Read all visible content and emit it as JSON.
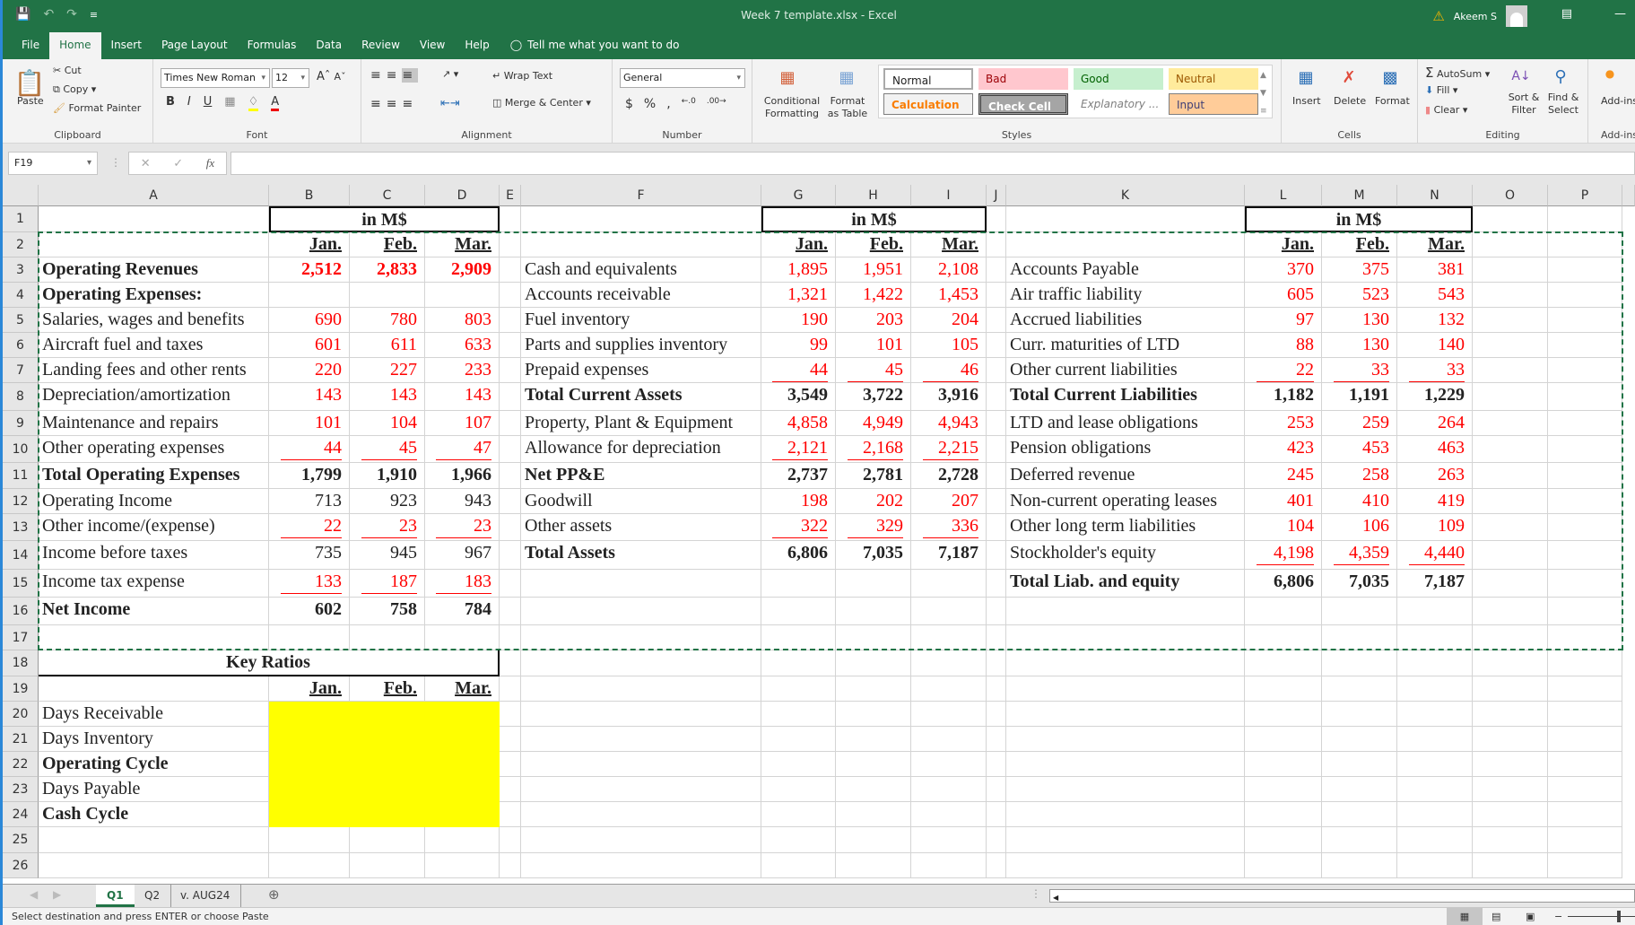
{
  "window": {
    "title": "Week 7 template.xlsx  -  Excel",
    "user": "Akeem S"
  },
  "ribbon_tabs": [
    "File",
    "Home",
    "Insert",
    "Page Layout",
    "Formulas",
    "Data",
    "Review",
    "View",
    "Help"
  ],
  "active_tab": "Home",
  "tell_me": "Tell me what you want to do",
  "clipboard": {
    "paste": "Paste",
    "cut": "Cut",
    "copy": "Copy",
    "format_painter": "Format Painter",
    "label": "Clipboard"
  },
  "font": {
    "name": "Times New Roman",
    "size": "12",
    "label": "Font",
    "bold": "B",
    "italic": "I",
    "underline": "U"
  },
  "alignment": {
    "wrap": "Wrap Text",
    "merge": "Merge & Center",
    "label": "Alignment"
  },
  "number": {
    "format": "General",
    "label": "Number",
    "currency": "$",
    "percent": "%",
    "comma": ","
  },
  "styles": {
    "conditional": "Conditional Formatting",
    "format_table": "Format as Table",
    "normal": "Normal",
    "bad": "Bad",
    "good": "Good",
    "neutral": "Neutral",
    "calculation": "Calculation",
    "check_cell": "Check Cell",
    "explanatory": "Explanatory ...",
    "input": "Input",
    "label": "Styles"
  },
  "cells_group": {
    "insert": "Insert",
    "delete": "Delete",
    "format": "Format",
    "label": "Cells"
  },
  "editing": {
    "autosum": "AutoSum",
    "fill": "Fill",
    "clear": "Clear",
    "sort": "Sort & Filter",
    "find": "Find & Select",
    "label": "Editing"
  },
  "addins": {
    "button": "Add-ins",
    "label": "Add-ins"
  },
  "formula_bar": {
    "name_box": "F19",
    "fx": "fx",
    "value": ""
  },
  "columns": [
    "A",
    "B",
    "C",
    "D",
    "E",
    "F",
    "G",
    "H",
    "I",
    "J",
    "K",
    "L",
    "M",
    "N",
    "O",
    "P"
  ],
  "rows": [
    "1",
    "2",
    "3",
    "4",
    "5",
    "6",
    "7",
    "8",
    "9",
    "10",
    "11",
    "12",
    "13",
    "14",
    "15",
    "16",
    "17",
    "18",
    "19",
    "20",
    "21",
    "22",
    "23",
    "24",
    "25",
    "26"
  ],
  "unit_label": "in M$",
  "months": [
    "Jan.",
    "Feb.",
    "Mar."
  ],
  "income_statement": [
    {
      "label": "Operating Revenues",
      "values": [
        "2,512",
        "2,833",
        "2,909"
      ],
      "bold": true,
      "red": true
    },
    {
      "label": "Operating Expenses:",
      "values": [
        "",
        "",
        ""
      ],
      "bold": true
    },
    {
      "label": "Salaries, wages and benefits",
      "values": [
        "690",
        "780",
        "803"
      ],
      "red": true
    },
    {
      "label": "Aircraft fuel and taxes",
      "values": [
        "601",
        "611",
        "633"
      ],
      "red": true
    },
    {
      "label": "Landing fees and other rents",
      "values": [
        "220",
        "227",
        "233"
      ],
      "red": true
    },
    {
      "label": "Depreciation/amortization",
      "values": [
        "143",
        "143",
        "143"
      ],
      "red": true
    },
    {
      "label": "Maintenance and repairs",
      "values": [
        "101",
        "104",
        "107"
      ],
      "red": true
    },
    {
      "label": "Other operating expenses",
      "values": [
        "44",
        "45",
        "47"
      ],
      "red": true,
      "sum": true
    },
    {
      "label": "Total Operating Expenses",
      "values": [
        "1,799",
        "1,910",
        "1,966"
      ],
      "bold": true
    },
    {
      "label": "Operating Income",
      "values": [
        "713",
        "923",
        "943"
      ]
    },
    {
      "label": "Other income/(expense)",
      "values": [
        "22",
        "23",
        "23"
      ],
      "red": true,
      "sum": true
    },
    {
      "label": "Income before taxes",
      "values": [
        "735",
        "945",
        "967"
      ]
    },
    {
      "label": "Income tax expense",
      "values": [
        "133",
        "187",
        "183"
      ],
      "red": true,
      "sum": true
    },
    {
      "label": "Net Income",
      "values": [
        "602",
        "758",
        "784"
      ],
      "bold": true
    }
  ],
  "assets": [
    {
      "label": "Cash and equivalents",
      "values": [
        "1,895",
        "1,951",
        "2,108"
      ],
      "red": true
    },
    {
      "label": "Accounts receivable",
      "values": [
        "1,321",
        "1,422",
        "1,453"
      ],
      "red": true
    },
    {
      "label": "Fuel inventory",
      "values": [
        "190",
        "203",
        "204"
      ],
      "red": true
    },
    {
      "label": "Parts and supplies inventory",
      "values": [
        "99",
        "101",
        "105"
      ],
      "red": true
    },
    {
      "label": "Prepaid expenses",
      "values": [
        "44",
        "45",
        "46"
      ],
      "red": true,
      "sum": true
    },
    {
      "label": "Total Current Assets",
      "values": [
        "3,549",
        "3,722",
        "3,916"
      ],
      "bold": true
    },
    {
      "label": "Property, Plant & Equipment",
      "values": [
        "4,858",
        "4,949",
        "4,943"
      ],
      "red": true
    },
    {
      "label": "Allowance for depreciation",
      "values": [
        "2,121",
        "2,168",
        "2,215"
      ],
      "red": true,
      "sum": true
    },
    {
      "label": "Net PP&E",
      "values": [
        "2,737",
        "2,781",
        "2,728"
      ],
      "bold": true
    },
    {
      "label": "Goodwill",
      "values": [
        "198",
        "202",
        "207"
      ],
      "red": true
    },
    {
      "label": "Other assets",
      "values": [
        "322",
        "329",
        "336"
      ],
      "red": true,
      "sum": true
    },
    {
      "label": "Total Assets",
      "values": [
        "6,806",
        "7,035",
        "7,187"
      ],
      "bold": true
    }
  ],
  "liabilities": [
    {
      "label": "Accounts Payable",
      "values": [
        "370",
        "375",
        "381"
      ],
      "red": true
    },
    {
      "label": "Air traffic liability",
      "values": [
        "605",
        "523",
        "543"
      ],
      "red": true
    },
    {
      "label": "Accrued liabilities",
      "values": [
        "97",
        "130",
        "132"
      ],
      "red": true
    },
    {
      "label": "Curr. maturities of LTD",
      "values": [
        "88",
        "130",
        "140"
      ],
      "red": true
    },
    {
      "label": "Other current liabilities",
      "values": [
        "22",
        "33",
        "33"
      ],
      "red": true,
      "sum": true
    },
    {
      "label": "Total Current Liabilities",
      "values": [
        "1,182",
        "1,191",
        "1,229"
      ],
      "bold": true
    },
    {
      "label": "LTD and lease obligations",
      "values": [
        "253",
        "259",
        "264"
      ],
      "red": true
    },
    {
      "label": "Pension obligations",
      "values": [
        "423",
        "453",
        "463"
      ],
      "red": true
    },
    {
      "label": "Deferred revenue",
      "values": [
        "245",
        "258",
        "263"
      ],
      "red": true
    },
    {
      "label": "Non-current operating leases",
      "values": [
        "401",
        "410",
        "419"
      ],
      "red": true
    },
    {
      "label": "Other long term liabilities",
      "values": [
        "104",
        "106",
        "109"
      ],
      "red": true
    },
    {
      "label": "Stockholder's equity",
      "values": [
        "4,198",
        "4,359",
        "4,440"
      ],
      "red": true,
      "sum": true
    },
    {
      "label": "Total Liab. and equity",
      "values": [
        "6,806",
        "7,035",
        "7,187"
      ],
      "bold": true
    }
  ],
  "key_ratios": {
    "title": "Key Ratios",
    "items": [
      {
        "label": "Days Receivable",
        "bold": false
      },
      {
        "label": "Days Inventory",
        "bold": false
      },
      {
        "label": "Operating Cycle",
        "bold": true
      },
      {
        "label": "Days Payable",
        "bold": false
      },
      {
        "label": "Cash Cycle",
        "bold": true
      }
    ],
    "fill_color": "#ffff00"
  },
  "sheets": [
    "Q1",
    "Q2",
    "v. AUG24"
  ],
  "active_sheet": "Q1",
  "status_text": "Select destination and press ENTER or choose Paste",
  "colors": {
    "excel_green": "#217346",
    "value_red": "#ff0000",
    "highlight": "#ffff00"
  }
}
